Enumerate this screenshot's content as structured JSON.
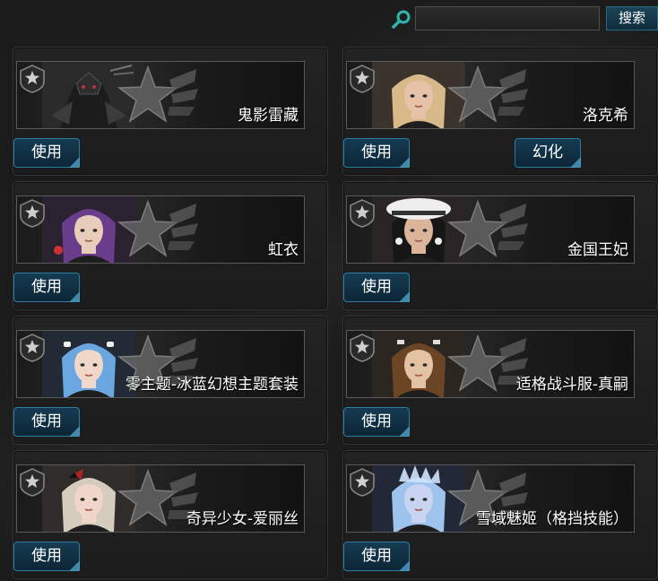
{
  "search": {
    "placeholder": "",
    "button_label": "搜索"
  },
  "cards": [
    {
      "name": "鬼影雷藏",
      "use_label": "使用",
      "theme": "dark-armor"
    },
    {
      "name": "洛克希",
      "use_label": "使用",
      "transform_label": "幻化",
      "theme": "blonde"
    },
    {
      "name": "虹衣",
      "use_label": "使用",
      "theme": "purple-hair"
    },
    {
      "name": "金国王妃",
      "use_label": "使用",
      "theme": "fur-hat"
    },
    {
      "name": "零主题-冰蓝幻想主题套装",
      "use_label": "使用",
      "theme": "blue-hair"
    },
    {
      "name": "适格战斗服-真嗣",
      "use_label": "使用",
      "theme": "brown-hair"
    },
    {
      "name": "奇异少女-爱丽丝",
      "use_label": "使用",
      "theme": "silver-hair"
    },
    {
      "name": "雪域魅姬（格挡技能）",
      "use_label": "使用",
      "theme": "ice-crown"
    }
  ],
  "colors": {
    "accent": "#2e7aa0",
    "button_bg": "#153b52",
    "search_icon": "#2fb6b0"
  }
}
